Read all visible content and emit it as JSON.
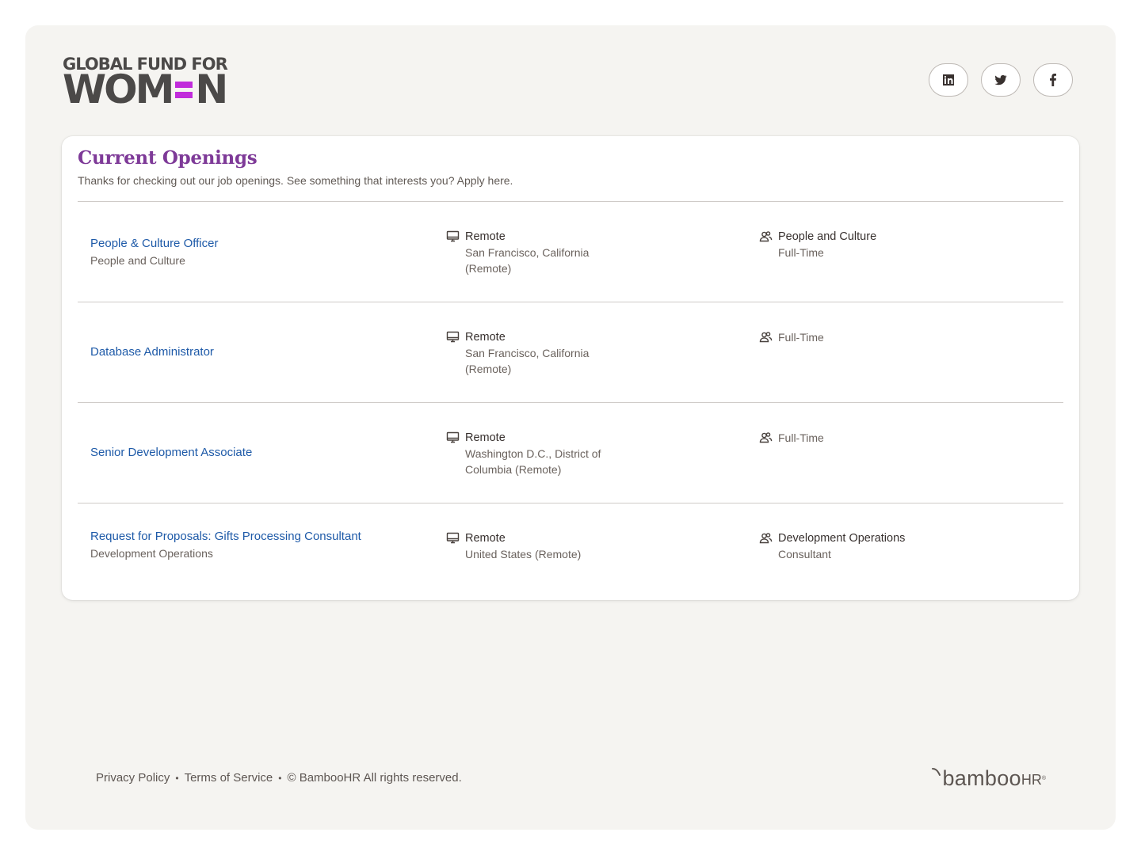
{
  "brand": {
    "logo_line1": "GLOBAL FUND FOR",
    "logo_line2_left": "WOM",
    "logo_line2_right": "N"
  },
  "socials": [
    {
      "icon": "linkedin-icon"
    },
    {
      "icon": "twitter-icon"
    },
    {
      "icon": "facebook-icon"
    }
  ],
  "openings": {
    "title": "Current Openings",
    "subtitle": "Thanks for checking out our job openings. See something that interests you? Apply here.",
    "jobs": [
      {
        "title": "People & Culture Officer",
        "department": "People and Culture",
        "location_type": "Remote",
        "location": "San Francisco, California (Remote)",
        "type_primary": "People and Culture",
        "type_secondary": "Full-Time"
      },
      {
        "title": "Database Administrator",
        "department": "",
        "location_type": "Remote",
        "location": "San Francisco, California (Remote)",
        "type_primary": "",
        "type_secondary": "Full-Time"
      },
      {
        "title": "Senior Development Associate",
        "department": "",
        "location_type": "Remote",
        "location": "Washington D.C., District of Columbia (Remote)",
        "type_primary": "",
        "type_secondary": "Full-Time"
      },
      {
        "title": "Request for Proposals: Gifts Processing Consultant",
        "department": "Development Operations",
        "location_type": "Remote",
        "location": "United States (Remote)",
        "type_primary": "Development Operations",
        "type_secondary": "Consultant"
      }
    ]
  },
  "footer": {
    "privacy": "Privacy Policy",
    "terms": "Terms of Service",
    "copyright": "© BambooHR All rights reserved.",
    "powered_word": "bamboo",
    "powered_suffix": "HR"
  }
}
